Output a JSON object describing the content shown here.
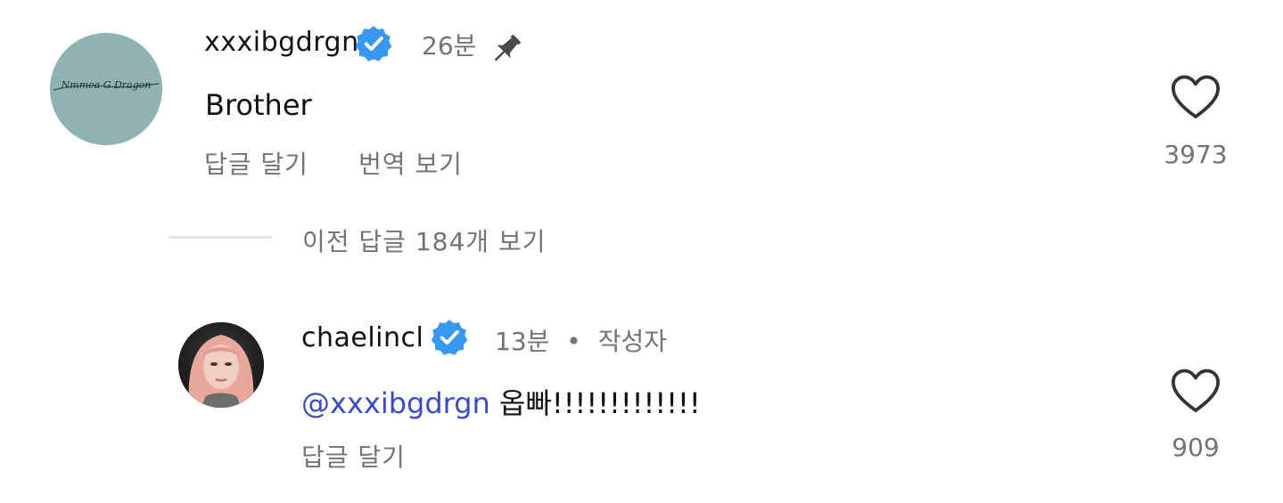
{
  "comments": [
    {
      "username": "xxxibgdrgn",
      "time": "26분",
      "text": "Brother",
      "actions": {
        "reply": "답글 달기",
        "translate": "번역 보기"
      },
      "likes": "3973",
      "avatar_signature": "Nmmea G Dragon"
    },
    {
      "username": "chaelincl",
      "time": "13분",
      "separator": "•",
      "author_tag": "작성자",
      "mention": "@xxxibgdrgn",
      "text": "옵빠!!!!!!!!!!!!!",
      "actions": {
        "reply": "답글 달기"
      },
      "likes": "909"
    }
  ],
  "view_previous_replies": "이전 답글 184개 보기",
  "colors": {
    "verified_badge": "#3897f0",
    "mention": "#3b4cc0",
    "secondary_text": "#737373"
  },
  "icons": [
    "verified-badge-icon",
    "pin-icon",
    "heart-icon"
  ]
}
